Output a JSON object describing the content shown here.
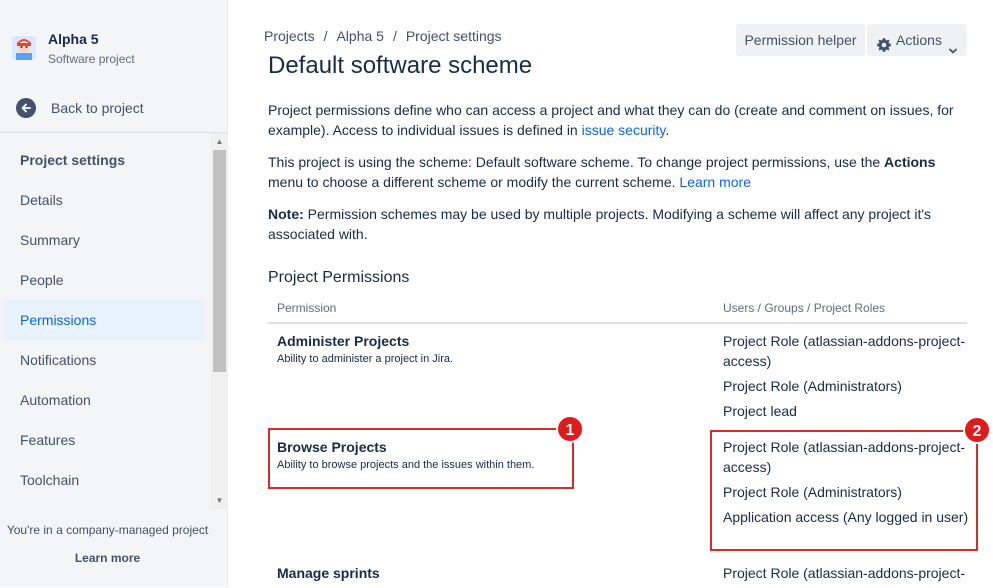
{
  "sidebar": {
    "project_name": "Alpha 5",
    "project_type": "Software project",
    "back_label": "Back to project",
    "heading": "Project settings",
    "items": [
      {
        "label": "Details",
        "active": false
      },
      {
        "label": "Summary",
        "active": false
      },
      {
        "label": "People",
        "active": false
      },
      {
        "label": "Permissions",
        "active": true
      },
      {
        "label": "Notifications",
        "active": false
      },
      {
        "label": "Automation",
        "active": false
      },
      {
        "label": "Features",
        "active": false
      },
      {
        "label": "Toolchain",
        "active": false
      }
    ],
    "footer_text": "You're in a company-managed project",
    "footer_link": "Learn more"
  },
  "breadcrumb": [
    "Projects",
    "Alpha 5",
    "Project settings"
  ],
  "header": {
    "title": "Default software scheme",
    "helper_button": "Permission helper",
    "actions_button": "Actions"
  },
  "intro": {
    "p1_text": "Project permissions define who can access a project and what they can do (create and comment on issues, for example). Access to individual issues is defined in ",
    "p1_link": "issue security",
    "p1_end": ".",
    "p2_text": "This project is using the scheme: Default software scheme. To change project permissions, use the ",
    "p2_bold": "Actions",
    "p2_text2": " menu to choose a different scheme or modify the current scheme. ",
    "p2_link": "Learn more",
    "p3_bold": "Note:",
    "p3_text": " Permission schemes may be used by multiple projects. Modifying a scheme will affect any project it's associated with."
  },
  "permissions": {
    "section_title": "Project Permissions",
    "col_permission": "Permission",
    "col_users": "Users / Groups / Project Roles",
    "rows": [
      {
        "name": "Administer Projects",
        "description": "Ability to administer a project in Jira.",
        "roles": [
          "Project Role (atlassian-addons-project-access)",
          "Project Role (Administrators)",
          "Project lead"
        ]
      },
      {
        "name": "Browse Projects",
        "description": "Ability to browse projects and the issues within them.",
        "roles": [
          "Project Role (atlassian-addons-project-access)",
          "Project Role (Administrators)",
          "Application access (Any logged in user)"
        ]
      },
      {
        "name": "Manage sprints",
        "description": "",
        "roles": [
          "Project Role (atlassian-addons-project-"
        ]
      }
    ]
  },
  "annotations": {
    "badge1": "1",
    "badge2": "2",
    "color": "#d92b2b"
  },
  "colors": {
    "accent": "#0c66e4",
    "active_bg": "#e9f2ff",
    "sidebar_bg": "#f4f5f7"
  }
}
